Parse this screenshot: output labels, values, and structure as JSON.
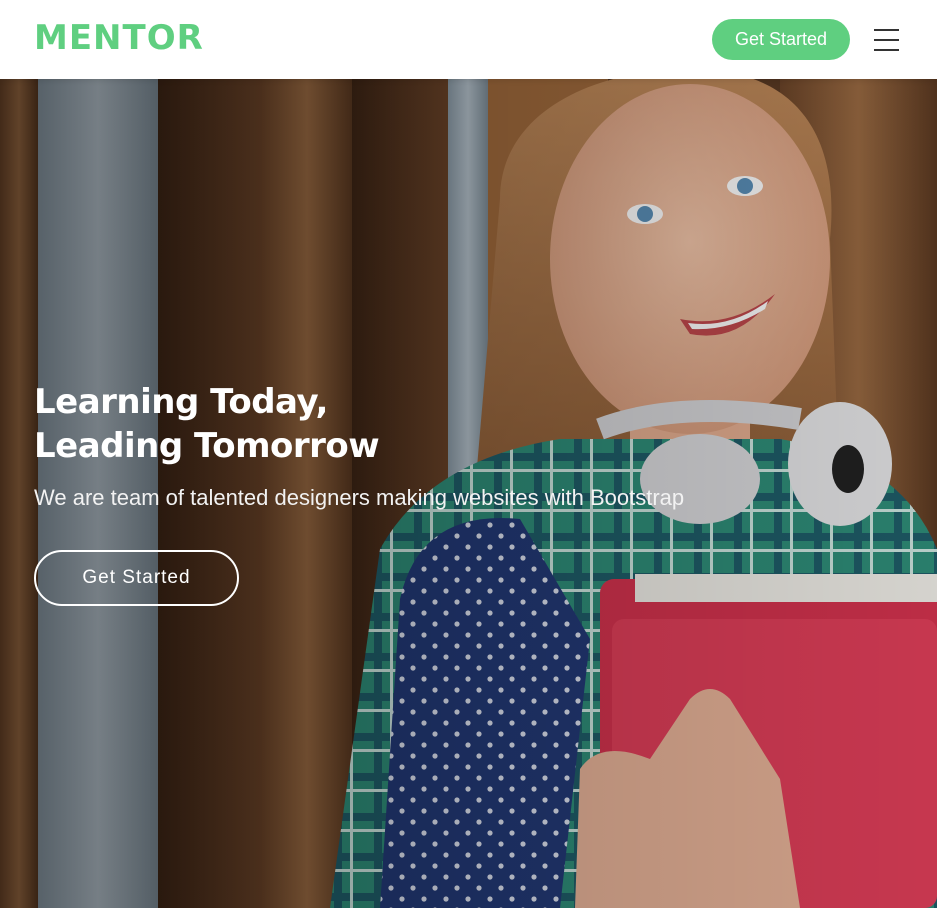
{
  "header": {
    "logo": "MENTOR",
    "cta_label": "Get Started",
    "menu_icon": "hamburger-menu-icon"
  },
  "hero": {
    "title_line1": "Learning Today,",
    "title_line2": "Leading Tomorrow",
    "subtitle": "We are team of talented designers making websites with Bootstrap",
    "cta_label": "Get Started",
    "image": "hero-photo-student"
  },
  "colors": {
    "brand": "#5fcf80",
    "header_bg": "#ffffff",
    "hero_text": "#ffffff"
  }
}
